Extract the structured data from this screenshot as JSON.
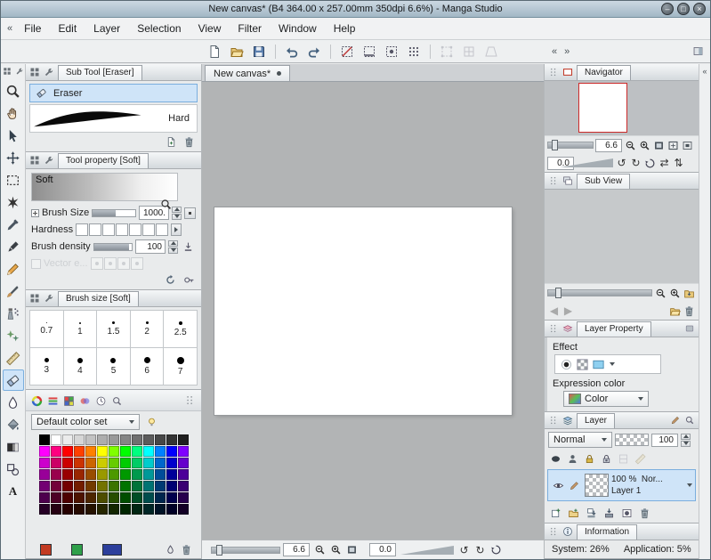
{
  "window": {
    "title": "New canvas* (B4 364.00 x 257.00mm 350dpi 6.6%)  - Manga Studio",
    "controls": [
      {
        "name": "minimize",
        "glyph": "–"
      },
      {
        "name": "maximize",
        "glyph": "□"
      },
      {
        "name": "close",
        "glyph": "×"
      }
    ]
  },
  "menu": {
    "collapse": "«",
    "items": [
      "File",
      "Edit",
      "Layer",
      "Selection",
      "View",
      "Filter",
      "Window",
      "Help"
    ]
  },
  "toolbar": {
    "groups": [
      [
        "new-file",
        "open-file",
        "save"
      ],
      [
        "undo",
        "redo"
      ],
      [
        "snap-off",
        "snap-ruler",
        "snap-special",
        "snap-grid"
      ],
      [
        "transform-disabled",
        "mesh-disabled",
        "perspective-disabled"
      ]
    ],
    "collapse_left": "«",
    "collapse_right": "»",
    "far_right": [
      "panel-toggle"
    ]
  },
  "tool_strip": {
    "header_icons": [
      "panel-menu",
      "wrench"
    ],
    "tools": [
      {
        "name": "zoom"
      },
      {
        "name": "hand"
      },
      {
        "name": "operation"
      },
      {
        "name": "move"
      },
      {
        "name": "selection"
      },
      {
        "name": "auto-select"
      },
      {
        "name": "eyedropper"
      },
      {
        "name": "pen"
      },
      {
        "name": "pencil"
      },
      {
        "name": "brush"
      },
      {
        "name": "airbrush"
      },
      {
        "name": "decoration"
      },
      {
        "name": "ruler"
      },
      {
        "name": "eraser",
        "selected": true
      },
      {
        "name": "blend"
      },
      {
        "name": "fill"
      },
      {
        "name": "gradient"
      },
      {
        "name": "figure"
      },
      {
        "name": "text"
      }
    ]
  },
  "subtool_panel": {
    "title": "Sub Tool [Eraser]",
    "header_icons": [
      "panel-menu",
      "wrench"
    ],
    "item_icon": [
      "eraser"
    ],
    "selected_item": "Eraser",
    "stroke_label": "Hard",
    "footer_icons": [
      "new-page",
      "trash"
    ]
  },
  "tool_property": {
    "title": "Tool property [Soft]",
    "header_icons": [
      "panel-menu",
      "wrench"
    ],
    "preview_label": "Soft",
    "preview_icons": [
      "zoom"
    ],
    "brush_size_label": "Brush Size",
    "brush_size_value": "1000.",
    "hardness_label": "Hardness",
    "density_label": "Brush density",
    "density_value": "100",
    "density_icons": [
      "intensity"
    ],
    "vector_label": "Vector e...",
    "footer_icons": [
      "refresh",
      "key"
    ]
  },
  "brush_size_panel": {
    "title": "Brush size [Soft]",
    "header_icons": [
      "panel-menu",
      "wrench"
    ],
    "sizes": [
      "0.7",
      "1",
      "1.5",
      "2",
      "2.5",
      "3",
      "4",
      "5",
      "6",
      "7"
    ]
  },
  "color_panel": {
    "tab_icons": [
      "color-wheel",
      "color-slider",
      "color-set",
      "color-mix",
      "color-history",
      "color-search"
    ],
    "grip_icons": [
      "grip"
    ],
    "set_name": "Default color set",
    "set_icons": [
      "lamp"
    ],
    "swatches": [
      "#000000",
      "#ffffff",
      "#ebebeb",
      "#d6d6d6",
      "#c2c2c2",
      "#adadad",
      "#999999",
      "#858585",
      "#707070",
      "#5c5c5c",
      "#474747",
      "#333333",
      "#1f1f1f",
      "#ff00ff",
      "#ff0080",
      "#ff0000",
      "#ff4000",
      "#ff8000",
      "#ffff00",
      "#80ff00",
      "#00ff00",
      "#00ff80",
      "#00ffff",
      "#0080ff",
      "#0000ff",
      "#8000ff",
      "#cc00cc",
      "#cc0066",
      "#cc0000",
      "#cc3300",
      "#cc6600",
      "#cccc00",
      "#66cc00",
      "#00cc00",
      "#00cc66",
      "#00cccc",
      "#0066cc",
      "#0000cc",
      "#6600cc",
      "#990099",
      "#99004d",
      "#990000",
      "#992600",
      "#994d00",
      "#999900",
      "#4d9900",
      "#009900",
      "#00994d",
      "#009999",
      "#004d99",
      "#000099",
      "#4d0099",
      "#730073",
      "#73003a",
      "#730000",
      "#731d00",
      "#733a00",
      "#737300",
      "#3a7300",
      "#007300",
      "#00733a",
      "#007373",
      "#003a73",
      "#000073",
      "#3a0073",
      "#4d004d",
      "#4d0026",
      "#4d0000",
      "#4d1300",
      "#4d2600",
      "#4d4d00",
      "#264d00",
      "#004d00",
      "#004d26",
      "#004d4d",
      "#00264d",
      "#00004d",
      "#26004d",
      "#260026",
      "#260013",
      "#260000",
      "#260a00",
      "#261300",
      "#262600",
      "#132600",
      "#002600",
      "#002613",
      "#002626",
      "#001326",
      "#000026",
      "#130026"
    ],
    "current_colors": [
      {
        "name": "main-color",
        "hex": "#c23b22"
      },
      {
        "name": "sub-color",
        "hex": "#2fa04a"
      },
      {
        "name": "transparent-color",
        "hex": "#2c3f9c",
        "wide": true
      }
    ],
    "footer_icons": [
      "droplet",
      "trash"
    ]
  },
  "navigator": {
    "title": "Navigator",
    "header_icons": [
      "grip",
      "navigator"
    ],
    "zoom_value": "6.6",
    "zoom_icons": [
      "magnify-minus",
      "magnify-plus",
      "fit-screen",
      "fit-window",
      "zoom-reset"
    ],
    "rotation_value": "0.0",
    "rotation_icons": [
      "rotate-ccw",
      "rotate-cw",
      "rotate-reset",
      "flip-h",
      "flip-v"
    ]
  },
  "sub_view": {
    "title": "Sub View",
    "header_icons": [
      "grip",
      "subview"
    ],
    "zoom_icons": [
      "magnify-minus",
      "magnify-plus",
      "import-image"
    ],
    "nav_icons_left": [
      "prev",
      "next"
    ],
    "nav_icons_right": [
      "open-file",
      "trash"
    ]
  },
  "layer_property": {
    "title": "Layer Property",
    "header_icons": [
      "grip",
      "layerprop"
    ],
    "header_right_icons": [
      "effects-tab"
    ],
    "effect_label": "Effect",
    "effect_icons": [
      "border-effect",
      "tone-effect",
      "layer-color-effect"
    ],
    "expression_label": "Expression color",
    "expression_value": "Color"
  },
  "layer_panel": {
    "title": "Layer",
    "header_icons": [
      "grip",
      "layers"
    ],
    "header_right_icons": [
      "pencil-edit",
      "search"
    ],
    "blend_mode": "Normal",
    "opacity_value": "100",
    "lock_icons": [
      "darken",
      "person",
      "lock",
      "lock-alpha",
      "clip-disabled",
      "ruler-disabled"
    ],
    "row_icons": [
      "eye",
      "pencil-edit"
    ],
    "layer_row": {
      "opacity_text": "100 %",
      "blend_text": "Nor...",
      "name": "Layer 1"
    },
    "bottom_icons": [
      "new-layer",
      "new-folder",
      "transfer-down",
      "merge-down",
      "mask",
      "trash"
    ]
  },
  "information_panel": {
    "title": "Information",
    "header_icons": [
      "grip",
      "info"
    ],
    "system_text": "System: 26%",
    "application_text": "Application: 5%"
  },
  "canvas": {
    "tab_label": "New canvas*",
    "status": {
      "zoom_value": "6.6",
      "zoom_icons": [
        "magnify-minus",
        "magnify-plus",
        "fit-screen"
      ],
      "rotation_value": "0.0",
      "rotation_icons": [
        "rotate-ccw",
        "rotate-cw",
        "rotate-reset"
      ]
    }
  },
  "right_edge": {
    "collapse": "«"
  }
}
